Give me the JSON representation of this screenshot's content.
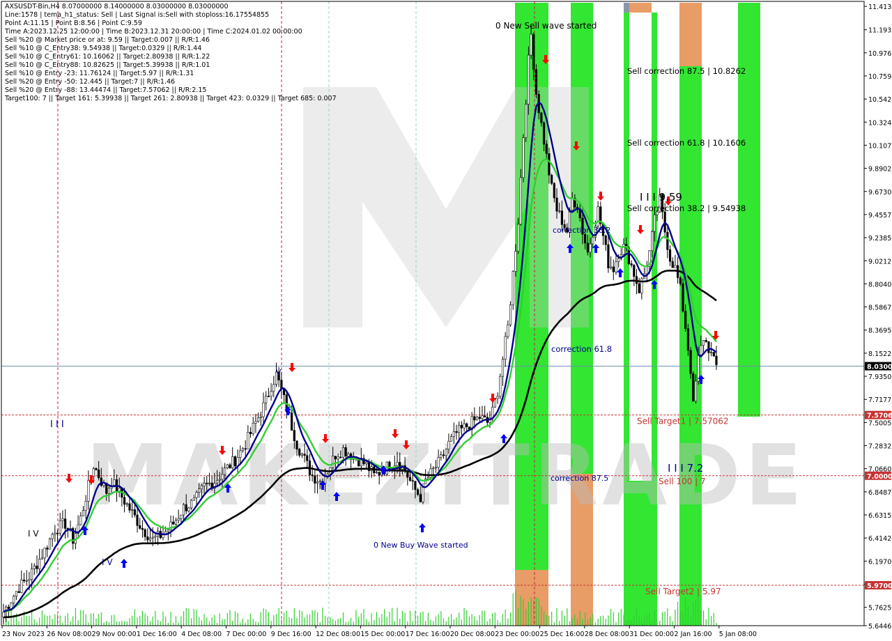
{
  "header": {
    "lines": [
      "AXSUSDT-Bin,H4  8.07000000 8.14000000 8.03000000 8.03000000",
      "Line:1578 | tema_h1_status: Sell | Last Signal is:Sell with stoploss:16.17554855",
      "Point A:11.15 | Point B:8.56 | Point C:9.59",
      "Time A:2023.12.25 12:00:00 | Time B:2023.12.31 20:00:00 | Time C:2024.01.02 00:00:00",
      "Sell %20 @ Market price or at: 9.59 || Target:0.007 || R/R:1.46",
      "Sell %10 @ C_Entry38: 9.54938 || Target:0.0329 || R/R:1.44",
      "Sell %10 @ C_Entry61: 10.16062 || Target:2.80938 || R/R:1.22",
      "Sell %10 @ C_Entry88: 10.82625 || Target:5.39938 || R/R:1.01",
      "Sell %10 @ Entry -23: 11.76124 || Target:5.97 || R/R:1.31",
      "Sell %20 @ Entry -50: 12.445 || Target:7 || R/R:1.46",
      "Sell %20 @ Entry -88: 13.44474 || Target:7.57062 || R/R:2.15",
      "Target100: 7 || Target 161: 5.39938 || Target 261: 2.80938 || Target 423: 0.0329 || Target 685: 0.007"
    ]
  },
  "watermark": "MAKEZITRADE",
  "colors": {
    "bull_candle": "#000000",
    "bear_candle": "#000000",
    "tema_fast": "#00008b",
    "tema_slow": "#32cd32",
    "long_ma": "#000000",
    "zone_green": "#32e632",
    "zone_orange": "#e89c66",
    "zone_grey": "#8c96aa",
    "vline": "#c81e50",
    "target_line": "#c83232",
    "sell_arrow": "#ff0000",
    "buy_arrow": "#0000ff",
    "price_label_bg": "#000000"
  },
  "chart_data": {
    "type": "candlestick",
    "symbol": "AXSUSDT-Bin",
    "timeframe": "H4",
    "ohlc_last": {
      "open": 8.07,
      "high": 8.14,
      "low": 8.03,
      "close": 8.03
    },
    "ylim": [
      5.59,
      11.46
    ],
    "yticks": [
      "11.41300",
      "11.19375",
      "10.97650",
      "10.75925",
      "10.54200",
      "10.32475",
      "10.10750",
      "9.89025",
      "9.67300",
      "9.45575",
      "9.23850",
      "9.02125",
      "8.80400",
      "8.58675",
      "8.36950",
      "8.15225",
      "7.93500",
      "7.71775",
      "7.50050",
      "7.28325",
      "7.06600",
      "6.84875",
      "6.63150",
      "6.41425",
      "6.19700",
      "5.97975",
      "5.76250",
      "5.59000"
    ],
    "ytick_labels": [
      "11.41300",
      "11.19375",
      "10.97650",
      "10.75925",
      "10.54200",
      "10.32475",
      "10.10750",
      "9.89025",
      "9.67300",
      "9.45575",
      "9.23850",
      "9.02125",
      "8.80400",
      "8.58675",
      "8.36950",
      "8.15225",
      "7.93500",
      "7.71775",
      "7.50050",
      "7.28325",
      "7.06600",
      "6.84875",
      "6.63150",
      "6.41425",
      "6.19700",
      "5.97975",
      "5.76250",
      "5.64462"
    ],
    "xtick_labels": [
      "23 Nov 2023",
      "26 Nov 08:00",
      "29 Nov 00:00",
      "1 Dec 16:00",
      "4 Dec 08:00",
      "7 Dec 00:00",
      "9 Dec 16:00",
      "12 Dec 08:00",
      "15 Dec 00:00",
      "17 Dec 16:00",
      "20 Dec 08:00",
      "23 Dec 00:00",
      "25 Dec 16:00",
      "28 Dec 08:00",
      "31 Dec 00:00",
      "2 Jan 16:00",
      "5 Jan 08:00"
    ],
    "current_price": {
      "value": 8.03,
      "label": "8.03000"
    },
    "levels": [
      {
        "value": 7.57062,
        "label": "Sell Target1 | 7.57062",
        "axis_label": "7.57062"
      },
      {
        "value": 7.0,
        "label": "Sell 100 | 7",
        "axis_label": "7.00000"
      },
      {
        "value": 5.97,
        "label": "Sell Target2 | 5.97",
        "axis_label": "5.97000"
      }
    ],
    "annotations": [
      {
        "text": "0 New Sell wave started"
      },
      {
        "text": "0 New Buy Wave started"
      },
      {
        "text": "Sell correction 87.5 | 10.8262"
      },
      {
        "text": "Sell correction 61.8 | 10.1606"
      },
      {
        "text": "Sell correction 38.2 | 9.54938"
      },
      {
        "text": "I I I 9.59"
      },
      {
        "text": "correction 38.2"
      },
      {
        "text": "correction 61.8"
      },
      {
        "text": "correction 87.5"
      },
      {
        "text": "I I I 7.2"
      },
      {
        "text": "I I I"
      },
      {
        "text": "I V"
      },
      {
        "text": "I V"
      },
      {
        "text": "V"
      }
    ],
    "price_path": [
      [
        0,
        5.72
      ],
      [
        6,
        5.95
      ],
      [
        10,
        6.05
      ],
      [
        16,
        6.3
      ],
      [
        20,
        6.5
      ],
      [
        24,
        6.55
      ],
      [
        27,
        6.4
      ],
      [
        30,
        6.6
      ],
      [
        33,
        6.9
      ],
      [
        35,
        7.1
      ],
      [
        37,
        7.0
      ],
      [
        40,
        6.85
      ],
      [
        42,
        6.95
      ],
      [
        46,
        6.8
      ],
      [
        50,
        6.65
      ],
      [
        54,
        6.5
      ],
      [
        58,
        6.4
      ],
      [
        62,
        6.45
      ],
      [
        66,
        6.55
      ],
      [
        70,
        6.7
      ],
      [
        74,
        6.75
      ],
      [
        78,
        6.9
      ],
      [
        82,
        6.95
      ],
      [
        86,
        7.05
      ],
      [
        90,
        7.15
      ],
      [
        94,
        7.3
      ],
      [
        98,
        7.5
      ],
      [
        102,
        7.7
      ],
      [
        104,
        7.85
      ],
      [
        106,
        7.95
      ],
      [
        108,
        7.8
      ],
      [
        111,
        7.55
      ],
      [
        114,
        7.3
      ],
      [
        117,
        7.15
      ],
      [
        120,
        7.0
      ],
      [
        123,
        6.95
      ],
      [
        126,
        7.05
      ],
      [
        129,
        7.2
      ],
      [
        132,
        7.25
      ],
      [
        135,
        7.2
      ],
      [
        138,
        7.15
      ],
      [
        141,
        7.1
      ],
      [
        144,
        7.0
      ],
      [
        147,
        7.05
      ],
      [
        150,
        7.1
      ],
      [
        153,
        7.15
      ],
      [
        156,
        7.05
      ],
      [
        159,
        6.9
      ],
      [
        162,
        6.8
      ],
      [
        164,
        6.95
      ],
      [
        167,
        7.05
      ],
      [
        170,
        7.15
      ],
      [
        173,
        7.3
      ],
      [
        176,
        7.4
      ],
      [
        179,
        7.45
      ],
      [
        182,
        7.5
      ],
      [
        185,
        7.55
      ],
      [
        188,
        7.5
      ],
      [
        190,
        7.6
      ],
      [
        192,
        7.8
      ],
      [
        194,
        8.1
      ],
      [
        196,
        8.4
      ],
      [
        198,
        8.9
      ],
      [
        200,
        9.4
      ],
      [
        202,
        10.2
      ],
      [
        204,
        10.9
      ],
      [
        205,
        11.15
      ],
      [
        207,
        10.6
      ],
      [
        209,
        10.3
      ],
      [
        211,
        10.0
      ],
      [
        213,
        9.7
      ],
      [
        215,
        9.5
      ],
      [
        217,
        9.4
      ],
      [
        219,
        9.3
      ],
      [
        221,
        9.6
      ],
      [
        223,
        9.55
      ],
      [
        225,
        9.3
      ],
      [
        227,
        9.1
      ],
      [
        229,
        9.3
      ],
      [
        231,
        9.5
      ],
      [
        233,
        9.25
      ],
      [
        235,
        9.0
      ],
      [
        237,
        8.95
      ],
      [
        239,
        9.1
      ],
      [
        241,
        9.15
      ],
      [
        243,
        9.05
      ],
      [
        245,
        8.9
      ],
      [
        247,
        8.75
      ],
      [
        249,
        8.9
      ],
      [
        251,
        9.1
      ],
      [
        253,
        9.4
      ],
      [
        255,
        9.59
      ],
      [
        257,
        9.3
      ],
      [
        259,
        9.05
      ],
      [
        261,
        8.95
      ],
      [
        263,
        8.75
      ],
      [
        265,
        8.4
      ],
      [
        267,
        8.0
      ],
      [
        268,
        7.65
      ],
      [
        270,
        8.1
      ],
      [
        272,
        8.3
      ],
      [
        274,
        8.2
      ],
      [
        276,
        8.07
      ],
      [
        277,
        8.03
      ]
    ]
  }
}
